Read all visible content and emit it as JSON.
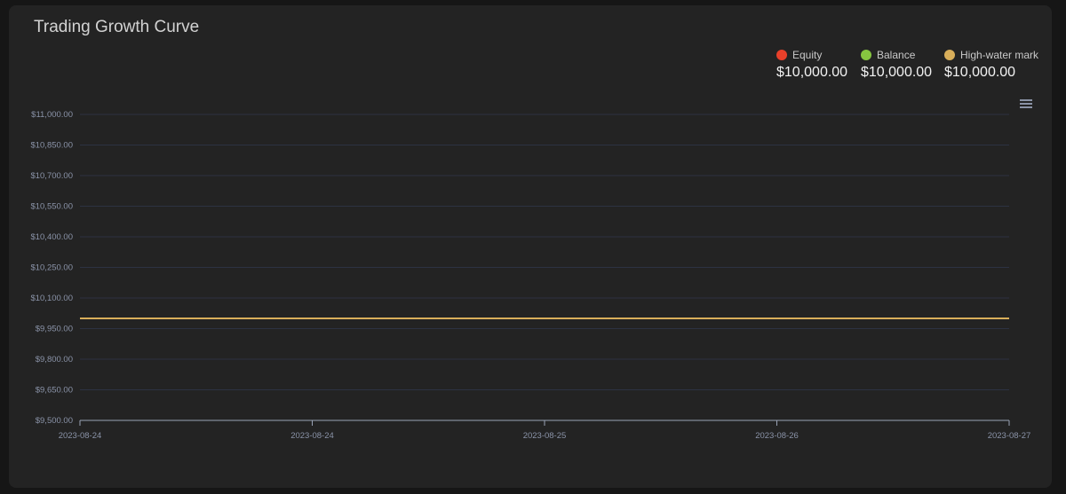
{
  "title": "Trading Growth Curve",
  "legend": [
    {
      "name": "Equity",
      "value": "$10,000.00",
      "color": "#e8402a"
    },
    {
      "name": "Balance",
      "value": "$10,000.00",
      "color": "#86c640"
    },
    {
      "name": "High-water mark",
      "value": "$10,000.00",
      "color": "#d8ae5a"
    }
  ],
  "menu_icon": "hamburger-menu-icon",
  "chart_data": {
    "type": "line",
    "x": [
      "2023-08-24",
      "2023-08-24",
      "2023-08-25",
      "2023-08-26",
      "2023-08-27"
    ],
    "ylim": [
      9500,
      11000
    ],
    "yticks": [
      "$9,500.00",
      "$9,650.00",
      "$9,800.00",
      "$9,950.00",
      "$10,100.00",
      "$10,250.00",
      "$10,400.00",
      "$10,550.00",
      "$10,700.00",
      "$10,850.00",
      "$11,000.00"
    ],
    "grid": true,
    "legend_position": "top-right",
    "series": [
      {
        "name": "Equity",
        "color": "#e8402a",
        "values": [
          10000,
          10000,
          10000,
          10000,
          10000
        ]
      },
      {
        "name": "Balance",
        "color": "#86c640",
        "values": [
          10000,
          10000,
          10000,
          10000,
          10000
        ]
      },
      {
        "name": "High-water mark",
        "color": "#d8ae5a",
        "values": [
          10000,
          10000,
          10000,
          10000,
          10000
        ]
      }
    ]
  }
}
